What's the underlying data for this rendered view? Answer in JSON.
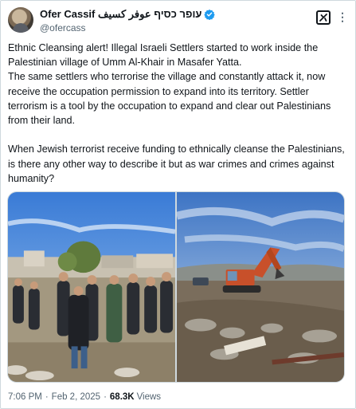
{
  "author": {
    "display_name": "Ofer Cassif עופר כסיף عوفر كسيف",
    "handle": "@ofercass",
    "verified": true
  },
  "header_icons": {
    "grok": "grok-x-icon",
    "more": "more-options-icon"
  },
  "post": {
    "text": "Ethnic Cleansing alert! Illegal Israeli Settlers started to work inside the Palestinian village of Umm Al-Khair in Masafer Yatta.\nThe same settlers who terrorise the village and constantly attack it, now receive the occupation permission to expand into its territory. Settler terrorism is a tool by the occupation to expand and clear out Palestinians from their land.\n\nWhen Jewish terrorist receive funding to ethnically cleanse the Palestinians, is there any other way to describe it but as war crimes and crimes against humanity?"
  },
  "media": [
    {
      "kind": "photo",
      "subject": "group-of-people-in-village"
    },
    {
      "kind": "photo",
      "subject": "excavator-on-hillside"
    }
  ],
  "meta": {
    "time": "7:06 PM",
    "separator": "·",
    "date": "Feb 2, 2025",
    "views_count": "68.3K",
    "views_label": "Views"
  },
  "colors": {
    "text": "#0f1419",
    "secondary": "#536471",
    "verified_blue": "#1d9bf0",
    "border": "#cfd9de"
  }
}
